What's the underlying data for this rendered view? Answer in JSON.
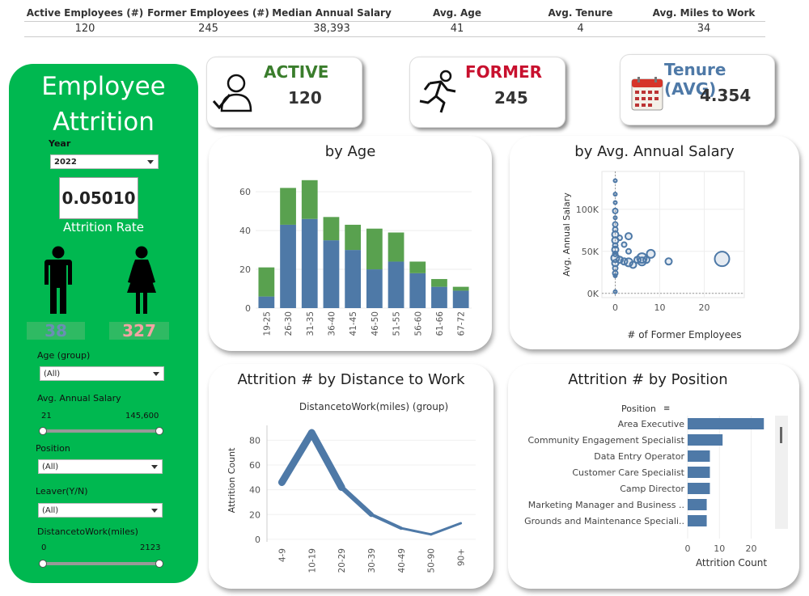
{
  "kpis": [
    {
      "label": "Active Employees (#)",
      "value": "120"
    },
    {
      "label": "Former Employees (#)",
      "value": "245"
    },
    {
      "label": "Median Annual Salary",
      "value": "38,393"
    },
    {
      "label": "Avg. Age",
      "value": "41"
    },
    {
      "label": "Avg. Tenure",
      "value": "4"
    },
    {
      "label": "Avg. Miles to Work",
      "value": "34"
    }
  ],
  "sidebar": {
    "title_line1": "Employee",
    "title_line2": "Attrition",
    "year_label": "Year",
    "year_value": "2022",
    "rate_value": "0.05010",
    "rate_label": "Attrition Rate",
    "male_count": "38",
    "female_count": "327",
    "age_label": "Age (group)",
    "age_value": "(All)",
    "salary_label": "Avg. Annual Salary",
    "salary_min": "21",
    "salary_max": "145,600",
    "position_label": "Position",
    "position_value": "(All)",
    "leaver_label": "Leaver(Y/N)",
    "leaver_value": "(All)",
    "distance_label": "DistancetoWork(miles)",
    "distance_min": "0",
    "distance_max": "2123"
  },
  "cards": {
    "active": {
      "label": "ACTIVE",
      "value": "120",
      "color": "#3a7d2c"
    },
    "former": {
      "label": "FORMER",
      "value": "245",
      "color": "#c8102e"
    },
    "tenure": {
      "label": "Tenure (AVG)",
      "value": "4.354",
      "color": "#4e79a7"
    }
  },
  "panels": {
    "age_title": "by Age",
    "salary_title": "by Avg. Annual Salary",
    "distance_title": "Attrition # by Distance to Work",
    "position_title": "Attrition # by Position"
  },
  "colors": {
    "green": "#00b850",
    "blue": "#4e79a7",
    "lightgreen": "#59a14f"
  },
  "chart_data": [
    {
      "id": "age",
      "type": "bar",
      "title": "by Age",
      "categories": [
        "19-25",
        "26-30",
        "31-35",
        "36-40",
        "41-45",
        "46-50",
        "51-55",
        "56-60",
        "61-66",
        "67-72"
      ],
      "series": [
        {
          "values": [
            6,
            43,
            46,
            35,
            30,
            20,
            24,
            18,
            11,
            9
          ]
        },
        {
          "values": [
            15,
            19,
            20,
            12,
            13,
            21,
            15,
            6,
            4,
            2
          ]
        }
      ],
      "yticks": [
        0,
        20,
        40,
        60
      ],
      "ylim": [
        0,
        68
      ]
    },
    {
      "id": "salary",
      "type": "scatter",
      "title": "by Avg. Annual Salary",
      "xlabel": "# of Former Employees",
      "ylabel": "Avg. Annual Salary",
      "xticks": [
        0,
        10,
        20
      ],
      "yticks": [
        "0K",
        "50K",
        "100K"
      ],
      "xlim": [
        -3,
        29
      ],
      "ylim": [
        -5000,
        145000
      ],
      "points": [
        [
          0,
          134000,
          2
        ],
        [
          0,
          118000,
          2
        ],
        [
          0,
          108000,
          2
        ],
        [
          0,
          98000,
          3
        ],
        [
          0,
          90000,
          2
        ],
        [
          0,
          82000,
          3
        ],
        [
          0,
          76000,
          3
        ],
        [
          0,
          70000,
          4
        ],
        [
          0,
          63000,
          4
        ],
        [
          0,
          57000,
          3
        ],
        [
          0,
          52000,
          4
        ],
        [
          0,
          47000,
          3
        ],
        [
          0,
          42000,
          5
        ],
        [
          0,
          36000,
          4
        ],
        [
          0,
          30000,
          3
        ],
        [
          0,
          24000,
          3
        ],
        [
          0,
          21000,
          2
        ],
        [
          0,
          2000,
          2
        ],
        [
          1,
          66000,
          3
        ],
        [
          1,
          40000,
          4
        ],
        [
          2,
          58000,
          3
        ],
        [
          2,
          38000,
          4
        ],
        [
          3,
          68000,
          4
        ],
        [
          3,
          50000,
          3
        ],
        [
          3,
          37000,
          5
        ],
        [
          4,
          34000,
          4
        ],
        [
          5,
          40000,
          4
        ],
        [
          6,
          42000,
          6
        ],
        [
          6,
          38000,
          5
        ],
        [
          7,
          40000,
          4
        ],
        [
          8,
          47000,
          5
        ],
        [
          12,
          38000,
          4
        ],
        [
          24,
          41000,
          9
        ]
      ]
    },
    {
      "id": "distance",
      "type": "line",
      "title": "DistancetoWork(miles) (group)",
      "ylabel": "Attrition Count",
      "categories": [
        "4-9",
        "10-19",
        "20-29",
        "30-39",
        "40-49",
        "50-90",
        "90+"
      ],
      "values": [
        46,
        86,
        42,
        20,
        9,
        4,
        13
      ],
      "yticks": [
        0,
        20,
        40,
        60,
        80
      ],
      "ylim": [
        -2,
        92
      ]
    },
    {
      "id": "position",
      "type": "bar",
      "orientation": "horizontal",
      "header": "Position",
      "xlabel": "Attrition Count",
      "categories": [
        "Area Executive",
        "Community Engagement Specialist",
        "Data Entry Operator",
        "Customer Care Specialist",
        "Camp Director",
        "Marketing Manager and Business ..",
        "Grounds and Maintenance Speciali.."
      ],
      "values": [
        24,
        11,
        7,
        7,
        7,
        6,
        6
      ],
      "xticks": [
        0,
        10,
        20
      ],
      "xlim": [
        0,
        27
      ]
    }
  ]
}
